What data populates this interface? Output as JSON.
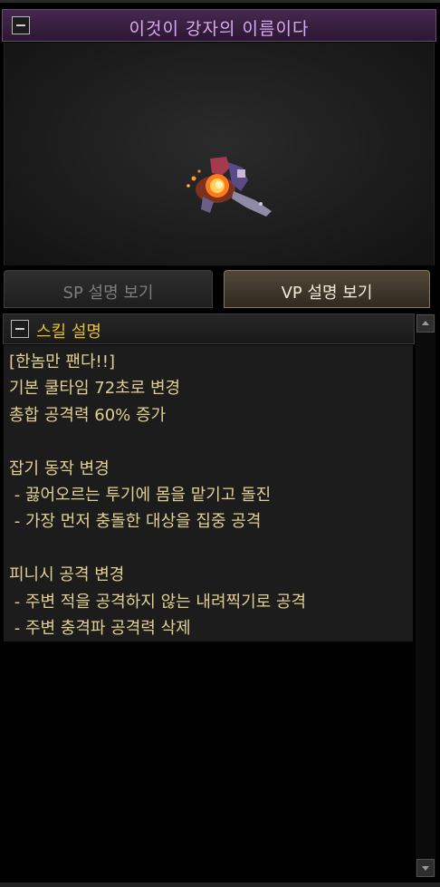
{
  "window": {
    "title": "이것이 강자의 이름이다",
    "accent_color": "#d9a9ee"
  },
  "tabs": {
    "sp_label": "SP 설명 보기",
    "vp_label": "VP 설명 보기",
    "active": "vp"
  },
  "skill": {
    "header_label": "스킬 설명",
    "description": [
      "[한놈만 팬다!!]",
      "기본 쿨타임 72초로 변경",
      "총합 공격력 60% 증가",
      "",
      "잡기 동작 변경",
      " - 끓어오르는 투기에 몸을 맡기고 돌진",
      " - 가장 먼저 충돌한 대상을 집중 공격",
      "",
      "피니시 공격 변경",
      " - 주변 적을 공격하지 않는 내려찍기로 공격",
      " - 주변 충격파 공격력 삭제"
    ]
  },
  "icons": {
    "minimize": "minimize-icon",
    "scroll_up": "scroll-up-arrow-icon",
    "scroll_down": "scroll-down-arrow-icon"
  }
}
